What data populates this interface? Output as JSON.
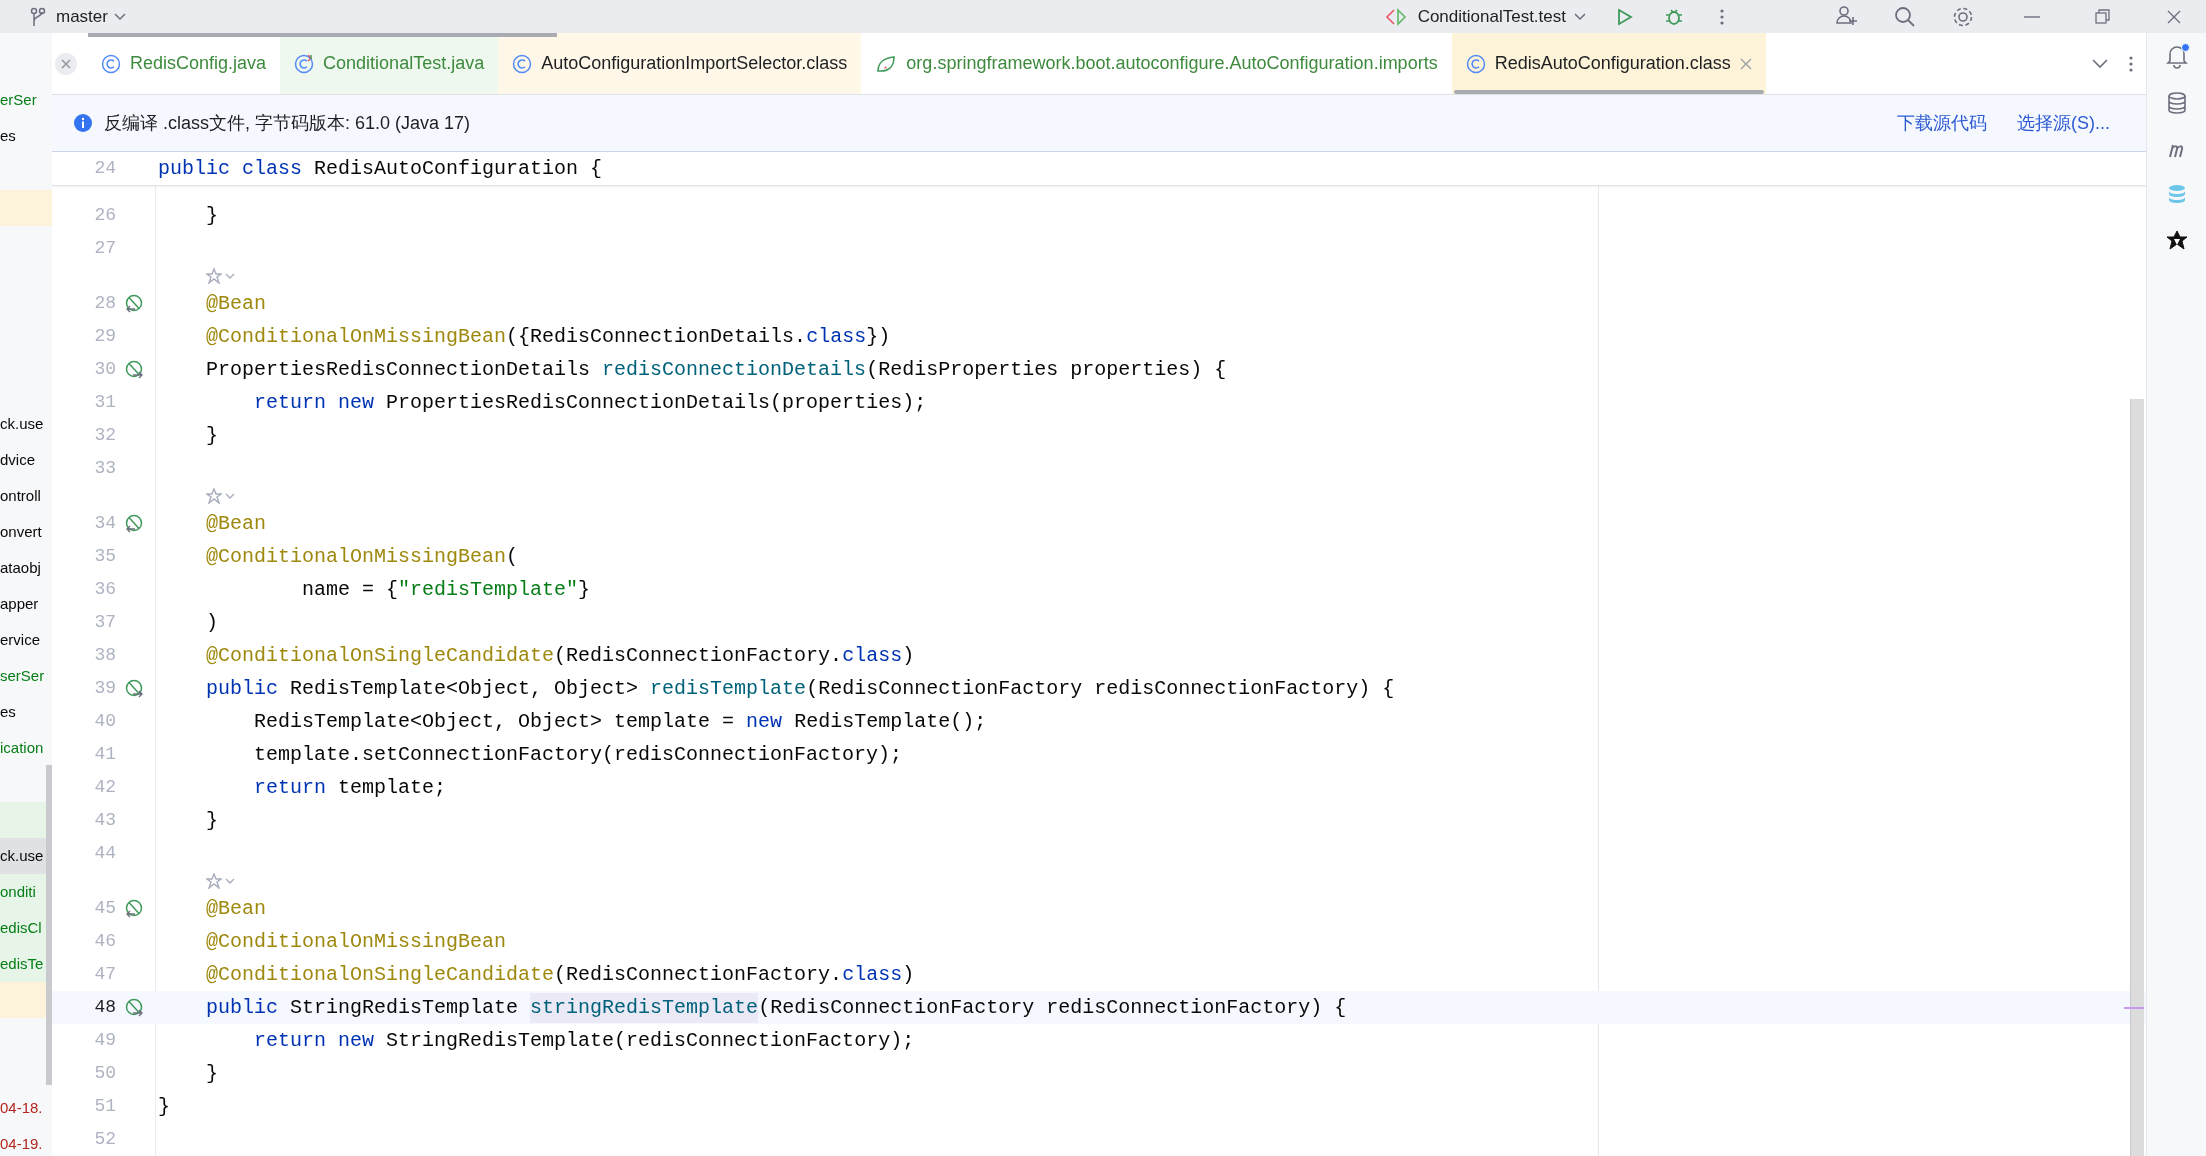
{
  "title_bar": {
    "branch": "master",
    "run_config": "ConditionalTest.test"
  },
  "project_tree": [
    {
      "kind": "changed",
      "text": "erSer"
    },
    {
      "kind": "plain",
      "text": "es"
    },
    {
      "kind": "blank"
    },
    {
      "kind": "blank",
      "color": "#fdf3da"
    },
    {
      "kind": "blank"
    },
    {
      "kind": "blank"
    },
    {
      "kind": "blank"
    },
    {
      "kind": "blank"
    },
    {
      "kind": "blank"
    },
    {
      "kind": "plain",
      "text": "ck.use"
    },
    {
      "kind": "plain",
      "text": "dvice"
    },
    {
      "kind": "plain",
      "text": "ontroll"
    },
    {
      "kind": "plain",
      "text": "onvert"
    },
    {
      "kind": "plain",
      "text": "ataobj"
    },
    {
      "kind": "plain",
      "text": "apper"
    },
    {
      "kind": "plain",
      "text": "ervice"
    },
    {
      "kind": "changed",
      "text": "serSer"
    },
    {
      "kind": "plain",
      "text": "es"
    },
    {
      "kind": "changed",
      "text": "ication"
    },
    {
      "kind": "blank"
    },
    {
      "kind": "blank",
      "color": "#e7f5e8"
    },
    {
      "kind": "plain",
      "text": "ck.use",
      "color": "#dfe1e5"
    },
    {
      "kind": "changed",
      "text": "onditi",
      "color": "#e7f5e8"
    },
    {
      "kind": "changed",
      "text": "edisCl",
      "color": "#e7f5e8"
    },
    {
      "kind": "changed",
      "text": "edisTe",
      "color": "#e7f5e8"
    },
    {
      "kind": "blank",
      "color": "#fdf3da"
    },
    {
      "kind": "blank"
    },
    {
      "kind": "blank"
    },
    {
      "kind": "error",
      "text": "04-18."
    },
    {
      "kind": "error",
      "text": "04-19."
    }
  ],
  "tabs": [
    {
      "label": "RedisConfig.java",
      "kind": "java",
      "modified": true,
      "color": "#ffffff",
      "selected": false
    },
    {
      "label": "ConditionalTest.java",
      "kind": "test",
      "modified": true,
      "color": "#eef8ef",
      "selected": false
    },
    {
      "label": "AutoConfigurationImportSelector.class",
      "kind": "java",
      "modified": false,
      "color": "#fff8e9",
      "selected": false
    },
    {
      "label": "org.springframework.boot.autoconfigure.AutoConfiguration.imports",
      "kind": "imports",
      "modified": true,
      "color": "#ffffff",
      "selected": false
    },
    {
      "label": "RedisAutoConfiguration.class",
      "kind": "java",
      "modified": false,
      "color": "#fdf3d9",
      "selected": true
    }
  ],
  "banner": {
    "message": "反编译 .class文件, 字节码版本: 61.0 (Java 17)",
    "actions": [
      "下载源代码",
      "选择源(S)..."
    ]
  },
  "editor": {
    "sticky_line": {
      "number": "24",
      "tokens": [
        {
          "kind": "keyword",
          "text": "public class"
        },
        {
          "kind": "plain",
          "text": " RedisAutoConfiguration {"
        }
      ]
    },
    "rows": [
      {
        "kind": "code",
        "number": "26",
        "current": false,
        "tokens": [
          {
            "kind": "plain",
            "text": "    }"
          }
        ]
      },
      {
        "kind": "code",
        "number": "27",
        "current": false
      },
      {
        "kind": "inlay"
      },
      {
        "kind": "code",
        "number": "28",
        "gutter": {
          "kind": "in"
        },
        "current": false,
        "tokens": [
          {
            "kind": "annotation",
            "text": "    @Bean"
          }
        ]
      },
      {
        "kind": "code",
        "number": "29",
        "current": false,
        "tokens": [
          {
            "kind": "annotation",
            "text": "    @ConditionalOnMissingBean"
          },
          {
            "kind": "plain",
            "text": "({RedisConnectionDetails."
          },
          {
            "kind": "keyword",
            "text": "class"
          },
          {
            "kind": "plain",
            "text": "})"
          }
        ]
      },
      {
        "kind": "code",
        "number": "30",
        "gutter": {
          "kind": "out"
        },
        "current": false,
        "tokens": [
          {
            "kind": "plain",
            "text": "    PropertiesRedisConnectionDetails "
          },
          {
            "kind": "method",
            "text": "redisConnectionDetails"
          },
          {
            "kind": "plain",
            "text": "(RedisProperties properties) {"
          }
        ]
      },
      {
        "kind": "code",
        "number": "31",
        "current": false,
        "tokens": [
          {
            "kind": "keyword",
            "text": "        return new"
          },
          {
            "kind": "plain",
            "text": " PropertiesRedisConnectionDetails(properties);"
          }
        ]
      },
      {
        "kind": "code",
        "number": "32",
        "current": false,
        "tokens": [
          {
            "kind": "plain",
            "text": "    }"
          }
        ]
      },
      {
        "kind": "code",
        "number": "33",
        "current": false
      },
      {
        "kind": "inlay"
      },
      {
        "kind": "code",
        "number": "34",
        "gutter": {
          "kind": "in"
        },
        "current": false,
        "tokens": [
          {
            "kind": "annotation",
            "text": "    @Bean"
          }
        ]
      },
      {
        "kind": "code",
        "number": "35",
        "current": false,
        "tokens": [
          {
            "kind": "annotation",
            "text": "    @ConditionalOnMissingBean"
          },
          {
            "kind": "plain",
            "text": "("
          }
        ]
      },
      {
        "kind": "code",
        "number": "36",
        "current": false,
        "tokens": [
          {
            "kind": "plain",
            "text": "            name = {"
          },
          {
            "kind": "string",
            "text": "\"redisTemplate\""
          },
          {
            "kind": "plain",
            "text": "}"
          }
        ]
      },
      {
        "kind": "code",
        "number": "37",
        "current": false,
        "tokens": [
          {
            "kind": "plain",
            "text": "    )"
          }
        ]
      },
      {
        "kind": "code",
        "number": "38",
        "current": false,
        "tokens": [
          {
            "kind": "annotation",
            "text": "    @ConditionalOnSingleCandidate"
          },
          {
            "kind": "plain",
            "text": "(RedisConnectionFactory."
          },
          {
            "kind": "keyword",
            "text": "class"
          },
          {
            "kind": "plain",
            "text": ")"
          }
        ]
      },
      {
        "kind": "code",
        "number": "39",
        "gutter": {
          "kind": "out"
        },
        "current": false,
        "tokens": [
          {
            "kind": "keyword",
            "text": "    public"
          },
          {
            "kind": "plain",
            "text": " RedisTemplate<Object, Object> "
          },
          {
            "kind": "method",
            "text": "redisTemplate"
          },
          {
            "kind": "plain",
            "text": "(RedisConnectionFactory redisConnectionFactory) {"
          }
        ]
      },
      {
        "kind": "code",
        "number": "40",
        "current": false,
        "tokens": [
          {
            "kind": "plain",
            "text": "        RedisTemplate<Object, Object> template = "
          },
          {
            "kind": "keyword",
            "text": "new"
          },
          {
            "kind": "plain",
            "text": " RedisTemplate();"
          }
        ]
      },
      {
        "kind": "code",
        "number": "41",
        "current": false,
        "tokens": [
          {
            "kind": "plain",
            "text": "        template.setConnectionFactory(redisConnectionFactory);"
          }
        ]
      },
      {
        "kind": "code",
        "number": "42",
        "current": false,
        "tokens": [
          {
            "kind": "keyword",
            "text": "        return"
          },
          {
            "kind": "plain",
            "text": " template;"
          }
        ]
      },
      {
        "kind": "code",
        "number": "43",
        "current": false,
        "tokens": [
          {
            "kind": "plain",
            "text": "    }"
          }
        ]
      },
      {
        "kind": "code",
        "number": "44",
        "current": false
      },
      {
        "kind": "inlay"
      },
      {
        "kind": "code",
        "number": "45",
        "gutter": {
          "kind": "in"
        },
        "current": false,
        "tokens": [
          {
            "kind": "annotation",
            "text": "    @Bean"
          }
        ]
      },
      {
        "kind": "code",
        "number": "46",
        "current": false,
        "tokens": [
          {
            "kind": "annotation",
            "text": "    @ConditionalOnMissingBean"
          }
        ]
      },
      {
        "kind": "code",
        "number": "47",
        "current": false,
        "tokens": [
          {
            "kind": "annotation",
            "text": "    @ConditionalOnSingleCandidate"
          },
          {
            "kind": "plain",
            "text": "(RedisConnectionFactory."
          },
          {
            "kind": "keyword",
            "text": "class"
          },
          {
            "kind": "plain",
            "text": ")"
          }
        ]
      },
      {
        "kind": "code",
        "number": "48",
        "gutter": {
          "kind": "out"
        },
        "current": true,
        "tokens": [
          {
            "kind": "keyword",
            "text": "    public"
          },
          {
            "kind": "plain",
            "text": " StringRedisTemplate "
          },
          {
            "kind": "method",
            "text": "stringRedisTemplate",
            "marked": true
          },
          {
            "kind": "plain",
            "text": "(RedisConnectionFactory redisConnectionFactory) {"
          }
        ]
      },
      {
        "kind": "code",
        "number": "49",
        "current": false,
        "tokens": [
          {
            "kind": "keyword",
            "text": "        return new"
          },
          {
            "kind": "plain",
            "text": " StringRedisTemplate(redisConnectionFactory);"
          }
        ]
      },
      {
        "kind": "code",
        "number": "50",
        "current": false,
        "tokens": [
          {
            "kind": "plain",
            "text": "    }"
          }
        ]
      },
      {
        "kind": "code",
        "number": "51",
        "current": false,
        "tokens": [
          {
            "kind": "plain",
            "text": "}"
          }
        ]
      },
      {
        "kind": "code",
        "number": "52",
        "current": false
      }
    ]
  },
  "notifications": {
    "unread": true
  }
}
